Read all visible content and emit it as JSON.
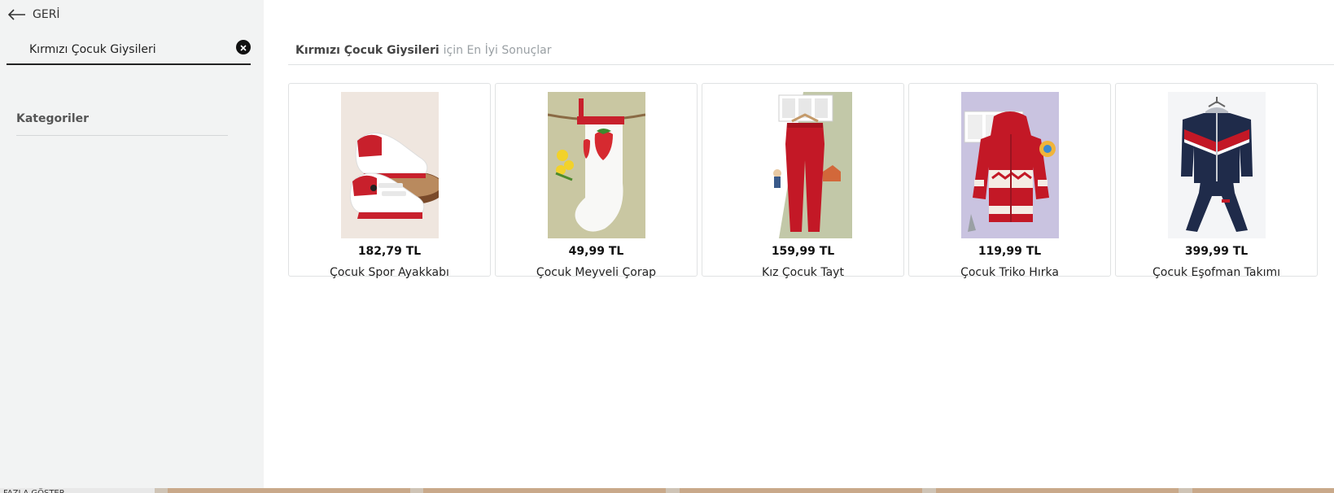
{
  "sidebar": {
    "back_label": "GERİ",
    "search_value": "Kırmızı Çocuk Giysileri",
    "categories_title": "Kategoriler"
  },
  "results": {
    "query": "Kırmızı Çocuk Giysileri",
    "suffix": "için En İyi Sonuçlar"
  },
  "products": [
    {
      "price": "182,79 TL",
      "name": "Çocuk Spor Ayakkabı",
      "image": "red-white-sneakers"
    },
    {
      "price": "49,99 TL",
      "name": "Çocuk Meyveli Çorap",
      "image": "white-sock-strawberry"
    },
    {
      "price": "159,99 TL",
      "name": "Kız Çocuk Tayt",
      "image": "red-leggings"
    },
    {
      "price": "119,99 TL",
      "name": "Çocuk Triko Hırka",
      "image": "red-knit-hoodie"
    },
    {
      "price": "399,99 TL",
      "name": "Çocuk Eşofman Takımı",
      "image": "navy-tracksuit"
    }
  ],
  "footer": {
    "more_label": "FAZLA GÖSTER"
  },
  "colors": {
    "sidebar_bg": "#f2f3f3",
    "accent_red": "#c8202c",
    "navy": "#1f2b4a"
  }
}
